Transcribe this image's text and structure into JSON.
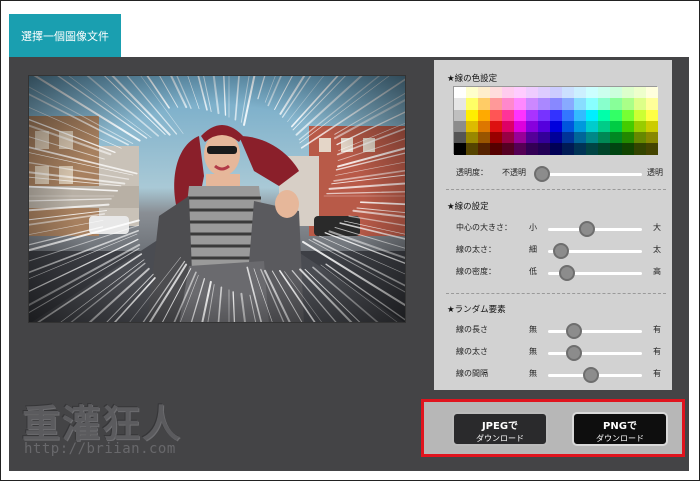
{
  "tab": {
    "label": "選擇一個圖像文件"
  },
  "watermark": {
    "title": "重灌狂人",
    "url": "http://briian.com"
  },
  "line_color": {
    "title": "★線の色設定",
    "opacity_label": "透明度：",
    "opacity_min": "不透明",
    "opacity_max": "透明",
    "opacity_value": 0,
    "palette": [
      [
        "#ffffff",
        "#ffffcc",
        "#ffeecc",
        "#ffdddd",
        "#ffccee",
        "#ffccff",
        "#eeccff",
        "#ddccff",
        "#ccccff",
        "#cce0ff",
        "#ccf0ff",
        "#ccffff",
        "#ccffee",
        "#ccffdd",
        "#ddffcc",
        "#eeffcc",
        "#ffffdd"
      ],
      [
        "#e6e6e6",
        "#ffff66",
        "#ffcc66",
        "#ff9999",
        "#ff88cc",
        "#ff88ff",
        "#cc88ff",
        "#aa88ff",
        "#8888ff",
        "#88aaff",
        "#88ddff",
        "#88ffff",
        "#88ffcc",
        "#88ff99",
        "#aaff88",
        "#ddff88",
        "#ffff99"
      ],
      [
        "#bfbfbf",
        "#ffee00",
        "#ffaa00",
        "#ff5555",
        "#ff3399",
        "#ff33ff",
        "#aa33ff",
        "#7733ff",
        "#3333ff",
        "#3377ff",
        "#33bbff",
        "#00eeff",
        "#00ffaa",
        "#33ff66",
        "#77ff33",
        "#ccff33",
        "#ffff44"
      ],
      [
        "#8c8c8c",
        "#ddbb00",
        "#dd7700",
        "#dd1111",
        "#dd0066",
        "#dd00dd",
        "#8800dd",
        "#5500dd",
        "#0000dd",
        "#0055dd",
        "#0099dd",
        "#00cccc",
        "#00cc88",
        "#00cc44",
        "#44cc00",
        "#99cc00",
        "#cccc00"
      ],
      [
        "#555555",
        "#998800",
        "#995500",
        "#990000",
        "#990044",
        "#990099",
        "#550099",
        "#330099",
        "#000099",
        "#003399",
        "#006699",
        "#008888",
        "#008855",
        "#008822",
        "#228800",
        "#668800",
        "#888800"
      ],
      [
        "#000000",
        "#554400",
        "#552200",
        "#550000",
        "#550022",
        "#550055",
        "#330055",
        "#220055",
        "#000055",
        "#001a55",
        "#003355",
        "#004444",
        "#00442a",
        "#004411",
        "#114400",
        "#334400",
        "#444400"
      ]
    ]
  },
  "line_settings": {
    "title": "★線の設定",
    "rows": [
      {
        "label": "中心の大きさ：",
        "min": "小",
        "max": "大",
        "value": 0.42
      },
      {
        "label": "線の太さ：",
        "min": "細",
        "max": "太",
        "value": 0.14
      },
      {
        "label": "線の密度：",
        "min": "低",
        "max": "高",
        "value": 0.2
      }
    ]
  },
  "random": {
    "title": "★ランダム要素",
    "rows": [
      {
        "label": "線の長さ",
        "min": "無",
        "max": "有",
        "value": 0.28
      },
      {
        "label": "線の太さ",
        "min": "無",
        "max": "有",
        "value": 0.28
      },
      {
        "label": "線の間隔",
        "min": "無",
        "max": "有",
        "value": 0.46
      }
    ]
  },
  "downloads": {
    "jpeg": {
      "line1": "JPEGで",
      "line2": "ダウンロード"
    },
    "png": {
      "line1": "PNGで",
      "line2": "ダウンロード"
    }
  }
}
